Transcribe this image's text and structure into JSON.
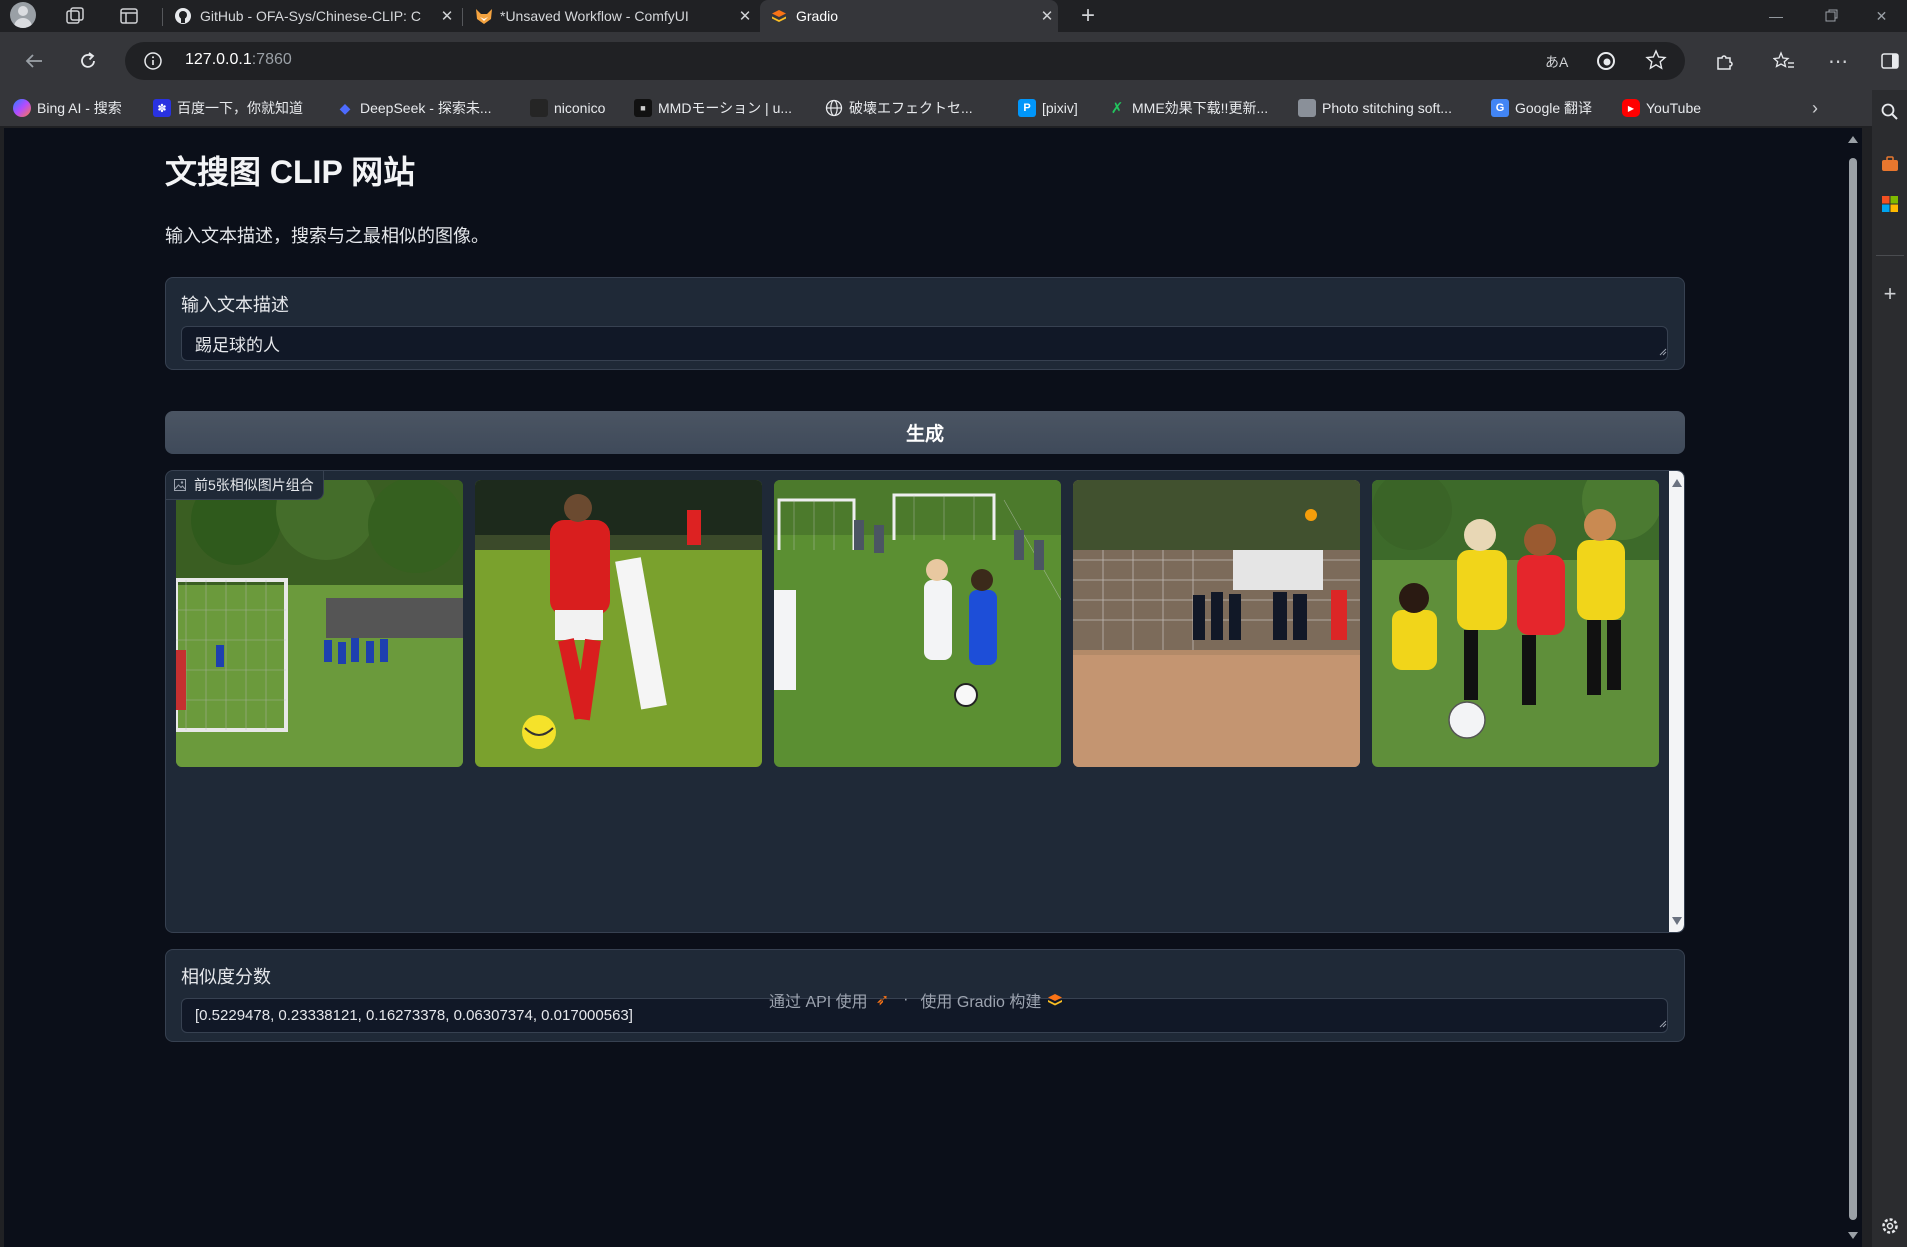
{
  "browser": {
    "tabs": [
      {
        "title": "GitHub - OFA-Sys/Chinese-CLIP: C",
        "favicon": "github-icon"
      },
      {
        "title": "*Unsaved Workflow - ComfyUI",
        "favicon": "comfyui-fox-icon"
      },
      {
        "title": "Gradio",
        "favicon": "gradio-icon"
      }
    ],
    "address": {
      "host": "127.0.0.1",
      "port": ":7860"
    },
    "translate_glyph": "あA",
    "bookmarks": [
      {
        "label": "Bing AI - 搜索",
        "icon": "bing-icon"
      },
      {
        "label": "百度一下，你就知道",
        "icon": "baidu-icon"
      },
      {
        "label": "DeepSeek - 探索未...",
        "icon": "deepseek-icon"
      },
      {
        "label": "niconico",
        "icon": "niconico-icon"
      },
      {
        "label": "MMDモーション | u...",
        "icon": "mmd-icon"
      },
      {
        "label": "破壊エフェクトセ...",
        "icon": "globe-icon"
      },
      {
        "label": "[pixiv]",
        "icon": "pixiv-icon"
      },
      {
        "label": "MME効果下载!!更新...",
        "icon": "mme-icon"
      },
      {
        "label": "Photo stitching soft...",
        "icon": "photo-icon"
      },
      {
        "label": "Google 翻译",
        "icon": "google-translate-icon"
      },
      {
        "label": "YouTube",
        "icon": "youtube-icon"
      }
    ]
  },
  "app": {
    "title": "文搜图 CLIP 网站",
    "description": "输入文本描述，搜索与之最相似的图像。",
    "input": {
      "label": "输入文本描述",
      "value": "踢足球的人"
    },
    "submit_label": "生成",
    "gallery": {
      "label": "前5张相似图片组合",
      "images": [
        {
          "name": "football-team-near-goal"
        },
        {
          "name": "player-number-10-red-kit"
        },
        {
          "name": "kids-match-blue-vs-white"
        },
        {
          "name": "players-on-dirt-field"
        },
        {
          "name": "girls-yellow-red-kits"
        }
      ]
    },
    "scores": {
      "label": "相似度分数",
      "value": "[0.5229478, 0.23338121, 0.16273378, 0.06307374, 0.017000563]"
    },
    "footer": {
      "api_label": "通过 API 使用",
      "separator": "·",
      "built_label": "使用 Gradio 构建"
    }
  },
  "colors": {
    "page_bg": "#0b0f19",
    "block_bg": "#1f2937",
    "button_bg": "#4b5563",
    "accent": "#f97316"
  }
}
